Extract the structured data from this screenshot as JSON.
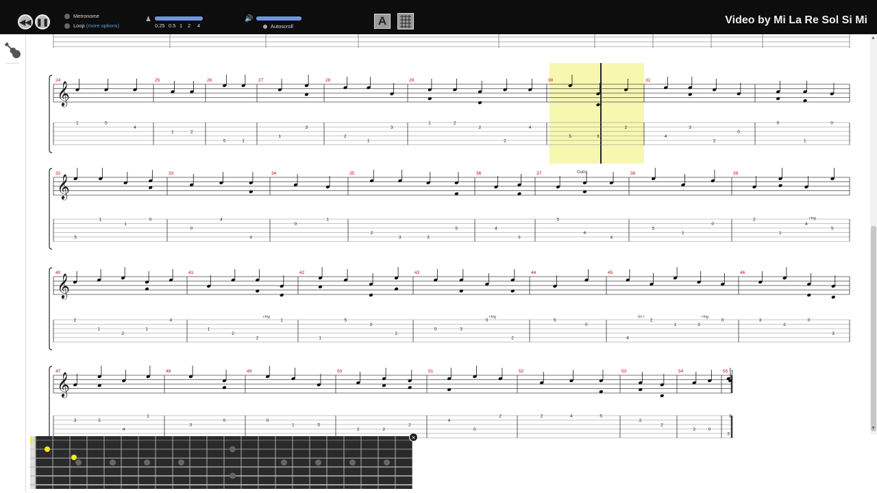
{
  "toolbar": {
    "metronome_label": "Metronome",
    "loop_label": "Loop",
    "loop_options_label": "(more options)",
    "speed_ticks": [
      "0.25",
      "0.5",
      "1",
      "2",
      "4"
    ],
    "autoscroll_label": "Autoscroll",
    "brand_text": "Video by Mi La Re Sol Si Mi"
  },
  "score": {
    "section_label": "Outro",
    "ring_label": "ring",
    "let_ring_label": "let r",
    "rows": [
      {
        "measures": [
          "24",
          "25",
          "26",
          "27",
          "28",
          "29",
          "30",
          "31"
        ]
      },
      {
        "measures": [
          "32",
          "33",
          "34",
          "35",
          "36",
          "37",
          "38",
          "39"
        ]
      },
      {
        "measures": [
          "40",
          "41",
          "42",
          "43",
          "44",
          "45",
          "46"
        ]
      },
      {
        "measures": [
          "47",
          "48",
          "49",
          "50",
          "51",
          "52",
          "53",
          "54",
          "55"
        ]
      }
    ],
    "highlight_measure": "29"
  },
  "fretboard": {
    "strings": 6,
    "frets": 22,
    "active_note_color": "#f2ea1c",
    "close_label": "×"
  },
  "colors": {
    "measure_number": "#cc0000",
    "highlight": "#f7f7b0",
    "toolbar_bg": "#0d0d0d"
  }
}
